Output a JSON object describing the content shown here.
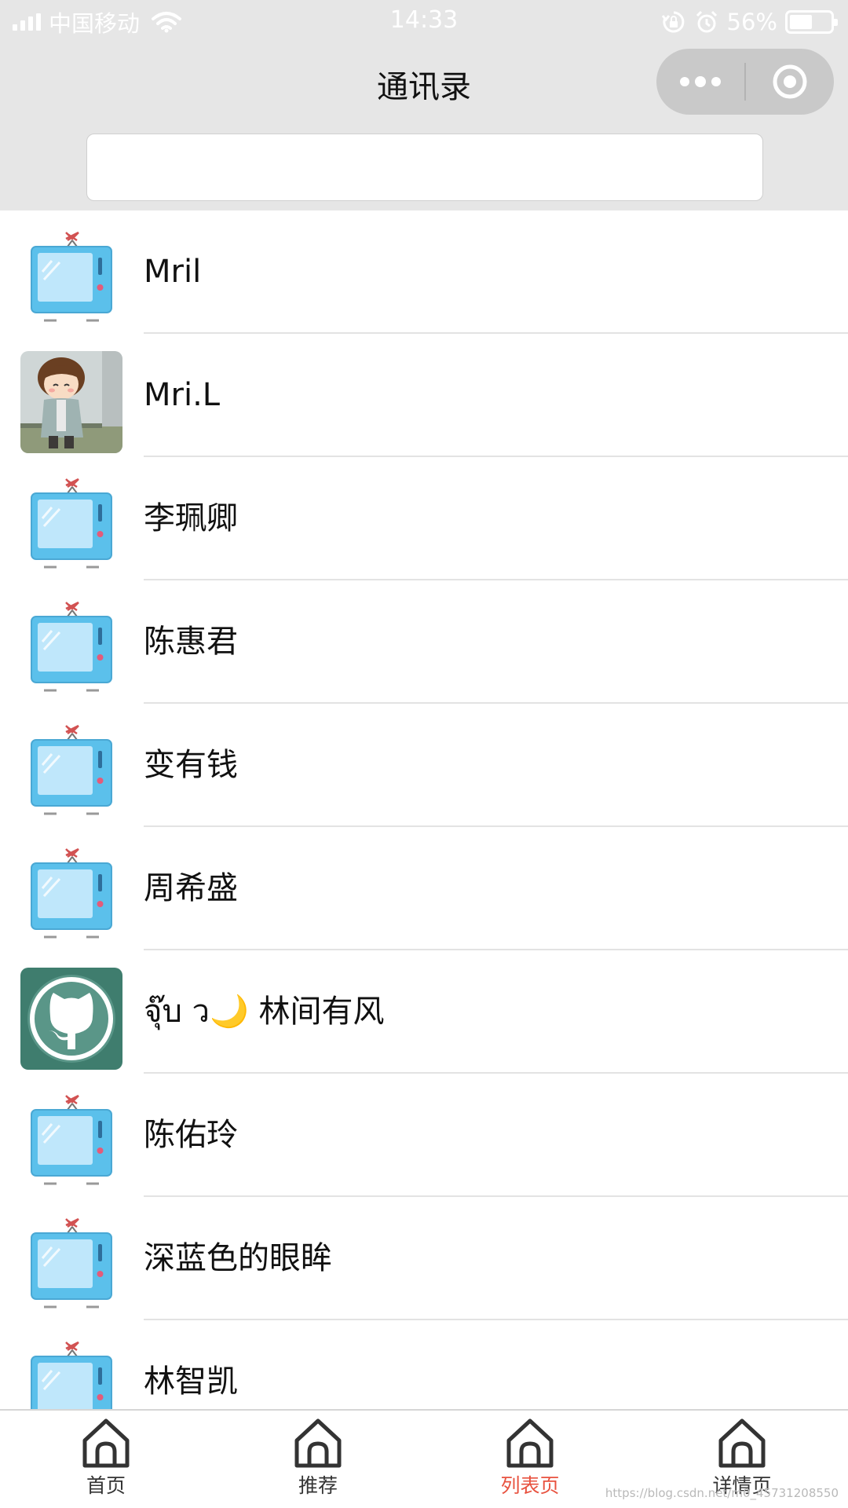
{
  "status_bar": {
    "carrier": "中国移动",
    "time": "14:33",
    "battery_percent": "56%",
    "battery_level": 0.56,
    "signal_bars": 4
  },
  "nav": {
    "title": "通讯录"
  },
  "search": {
    "value": "",
    "placeholder": ""
  },
  "contacts": [
    {
      "name": "Mril",
      "avatar": "tv-icon"
    },
    {
      "name": "Mri.L",
      "avatar": "boy-photo"
    },
    {
      "name": "李珮卿",
      "avatar": "tv-icon"
    },
    {
      "name": "陈惠君",
      "avatar": "tv-icon"
    },
    {
      "name": "变有钱",
      "avatar": "tv-icon"
    },
    {
      "name": "周希盛",
      "avatar": "tv-icon"
    },
    {
      "name": "จุ๊บ ว🌙 林间有风",
      "avatar": "github-octocat"
    },
    {
      "name": "陈佑玲",
      "avatar": "tv-icon"
    },
    {
      "name": "深蓝色的眼眸",
      "avatar": "tv-icon"
    },
    {
      "name": "林智凯",
      "avatar": "tv-icon"
    }
  ],
  "tab_bar": {
    "tabs": [
      {
        "label": "首页",
        "icon": "home-icon",
        "active": false
      },
      {
        "label": "推荐",
        "icon": "home-icon",
        "active": false
      },
      {
        "label": "列表页",
        "icon": "home-icon",
        "active": true
      },
      {
        "label": "详情页",
        "icon": "home-icon",
        "active": false
      }
    ]
  },
  "watermark": "https://blog.csdn.net/m0_45731208550",
  "colors": {
    "header_bg": "#e6e6e6",
    "active_tab": "#e8523f",
    "tv_blue": "#5bc0eb"
  }
}
